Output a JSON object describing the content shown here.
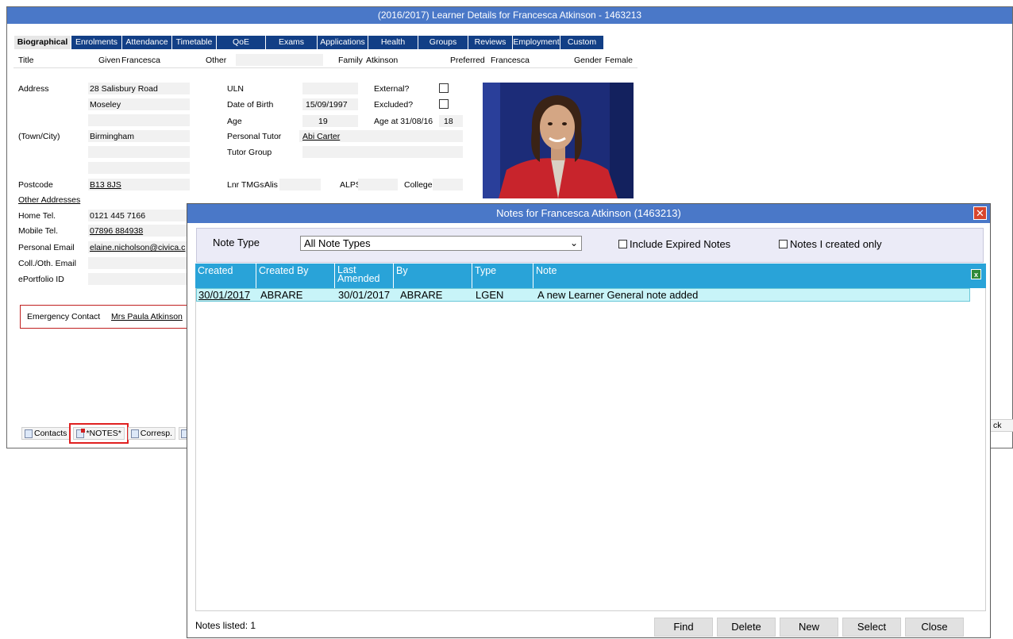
{
  "window_title": "(2016/2017) Learner Details for Francesca Atkinson - 1463213",
  "tabs": [
    "Biographical",
    "Enrolments",
    "Attendance",
    "Timetable",
    "QoE",
    "Exams",
    "Applications",
    "Health",
    "Groups",
    "Reviews",
    "Employment",
    "Custom"
  ],
  "name_row": {
    "title_label": "Title",
    "given_label": "Given",
    "given_value": "Francesca",
    "other_label": "Other",
    "family_label": "Family",
    "family_value": "Atkinson",
    "preferred_label": "Preferred",
    "preferred_value": "Francesca",
    "gender_label": "Gender",
    "gender_value": "Female"
  },
  "address": {
    "label": "Address",
    "line1": "28 Salisbury Road",
    "line2": "Moseley",
    "town_label": "(Town/City)",
    "town": "Birmingham",
    "postcode_label": "Postcode",
    "postcode": "B13 8JS",
    "other_addresses": "Other Addresses"
  },
  "contact": {
    "home_label": "Home Tel.",
    "home": "0121 445 7166",
    "mobile_label": "Mobile Tel.",
    "mobile": "07896 884938",
    "personal_email_label": "Personal Email",
    "personal_email": "elaine.nicholson@civica.c",
    "coll_email_label": "Coll./Oth. Email",
    "eportfolio_label": "ePortfolio ID"
  },
  "details": {
    "uln_label": "ULN",
    "dob_label": "Date of Birth",
    "dob": "15/09/1997",
    "age_label": "Age",
    "age": "19",
    "tutor_label": "Personal Tutor",
    "tutor": "Abi Carter",
    "tutor_group_label": "Tutor Group",
    "external_label": "External?",
    "excluded_label": "Excluded?",
    "age_at_label": "Age at 31/08/16",
    "age_at": "18",
    "lnr_tmgs_label": "Lnr TMGs:",
    "alis_label": "Alis",
    "alps_label": "ALPS",
    "college_label": "College"
  },
  "emergency": {
    "label": "Emergency Contact",
    "name": "Mrs Paula Atkinson"
  },
  "bottom_tabs": {
    "contacts": "Contacts",
    "notes": "*NOTES*",
    "corresp": "Corresp.",
    "right_fragment": "ck"
  },
  "dialog": {
    "title": "Notes for Francesca Atkinson (1463213)",
    "note_type_label": "Note Type",
    "note_type_value": "All Note Types",
    "include_expired": "Include Expired Notes",
    "created_only": "Notes I created only",
    "columns": [
      "Created",
      "Created By",
      "Last Amended",
      "By",
      "Type",
      "Note"
    ],
    "rows": [
      {
        "created": "30/01/2017",
        "created_by": "ABRARE",
        "last_amended": "30/01/2017",
        "by": "ABRARE",
        "type": "LGEN",
        "note": "A new Learner General note added"
      }
    ],
    "notes_listed": "Notes listed: 1",
    "buttons": {
      "find": "Find",
      "delete": "Delete",
      "new": "New",
      "select": "Select",
      "close": "Close"
    }
  },
  "colors": {
    "title_bar": "#4a78c8",
    "tab_bg": "#123f86",
    "grid_header": "#29a3d8",
    "row_highlight": "#c8f4f8",
    "highlight_box": "#e02020"
  }
}
